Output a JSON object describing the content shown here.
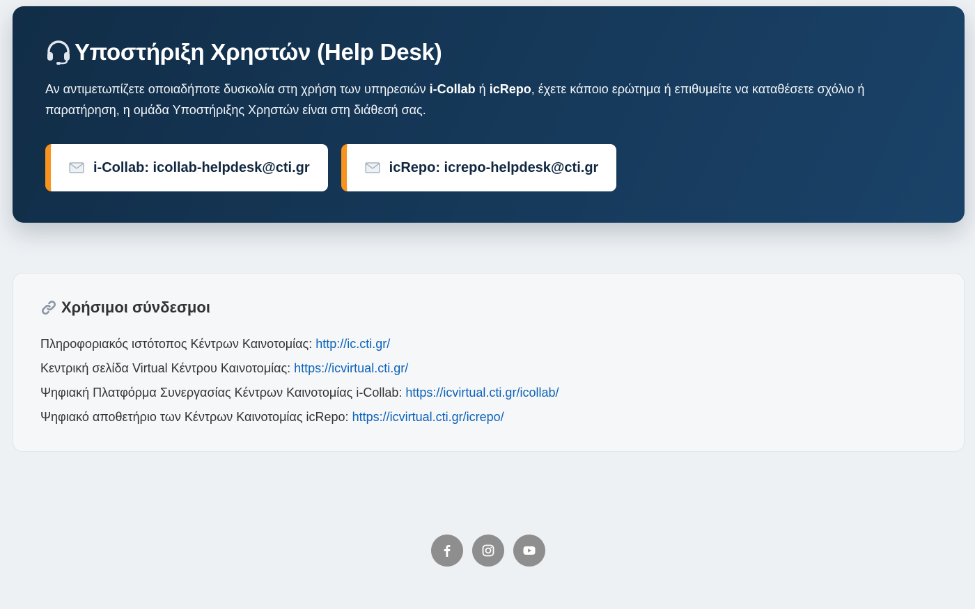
{
  "hero": {
    "title": "Υποστήριξη Χρηστών (Help Desk)",
    "desc_part1": "Αν αντιμετωπίζετε οποιαδήποτε δυσκολία στη χρήση των υπηρεσιών ",
    "desc_bold1": "i-Collab",
    "desc_part2": " ή ",
    "desc_bold2": "icRepo",
    "desc_part3": ", έχετε κάποιο ερώτημα ή επιθυμείτε να καταθέσετε σχόλιο ή παρατήρηση, η ομάδα Υποστήριξης Χρηστών είναι στη διάθεσή σας.",
    "contacts": [
      {
        "label": "i-Collab: icollab-helpdesk@cti.gr",
        "icon": "envelope-icon"
      },
      {
        "label": "icRepo: icrepo-helpdesk@cti.gr",
        "icon": "envelope-icon"
      }
    ],
    "headset_icon": "headset-icon"
  },
  "links": {
    "title": "Χρήσιμοι σύνδεσμοι",
    "icon": "link-icon",
    "items": [
      {
        "text": "Πληροφοριακός ιστότοπος Κέντρων Καινοτομίας: ",
        "url": "http://ic.cti.gr/"
      },
      {
        "text": "Κεντρική σελίδα Virtual Κέντρου Καινοτομίας: ",
        "url": "https://icvirtual.cti.gr/"
      },
      {
        "text": "Ψηφιακή Πλατφόρμα Συνεργασίας Κέντρων Καινοτομίας i-Collab: ",
        "url": "https://icvirtual.cti.gr/icollab/"
      },
      {
        "text": "Ψηφιακό αποθετήριο των Κέντρων Καινοτομίας icRepo: ",
        "url": "https://icvirtual.cti.gr/icrepo/"
      }
    ]
  },
  "social": [
    {
      "name": "facebook-icon"
    },
    {
      "name": "instagram-icon"
    },
    {
      "name": "youtube-icon"
    }
  ],
  "colors": {
    "hero_bg": "#112d47",
    "accent": "#f7931e",
    "link": "#0b62b8",
    "social_bg": "#8e8e8e"
  }
}
